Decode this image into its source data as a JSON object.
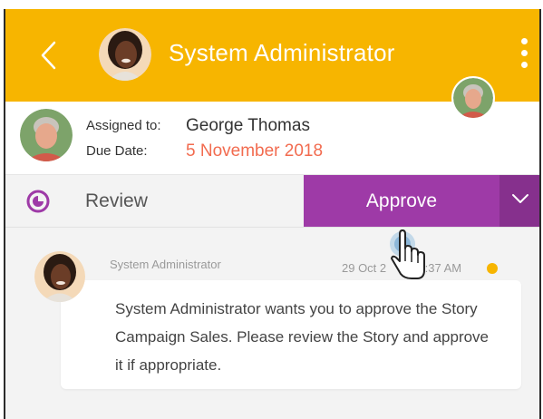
{
  "header": {
    "title": "System Administrator",
    "back_icon": "chevron-left-icon",
    "menu_icon": "more-vertical-icon",
    "background": "#f7b500"
  },
  "assignment": {
    "assigned_label": "Assigned to:",
    "assigned_value": "George Thomas",
    "due_label": "Due Date:",
    "due_value": "5 November 2018",
    "due_color": "#f26b4f"
  },
  "actions": {
    "review_label": "Review",
    "review_icon": "clock-icon",
    "approve_label": "Approve",
    "approve_color": "#9e3aa7",
    "dropdown_icon": "chevron-down-icon"
  },
  "comment": {
    "author": "System Administrator",
    "timestamp": "29 Oct 2018 10:37 AM",
    "timestamp_visible": "29 Oct 2",
    "timestamp_tail": "10:37 AM",
    "text": "System Administrator wants you to approve the Story Campaign Sales. Please review the Story and approve it if appropriate."
  },
  "cursor_icon": "hand-pointer-icon"
}
